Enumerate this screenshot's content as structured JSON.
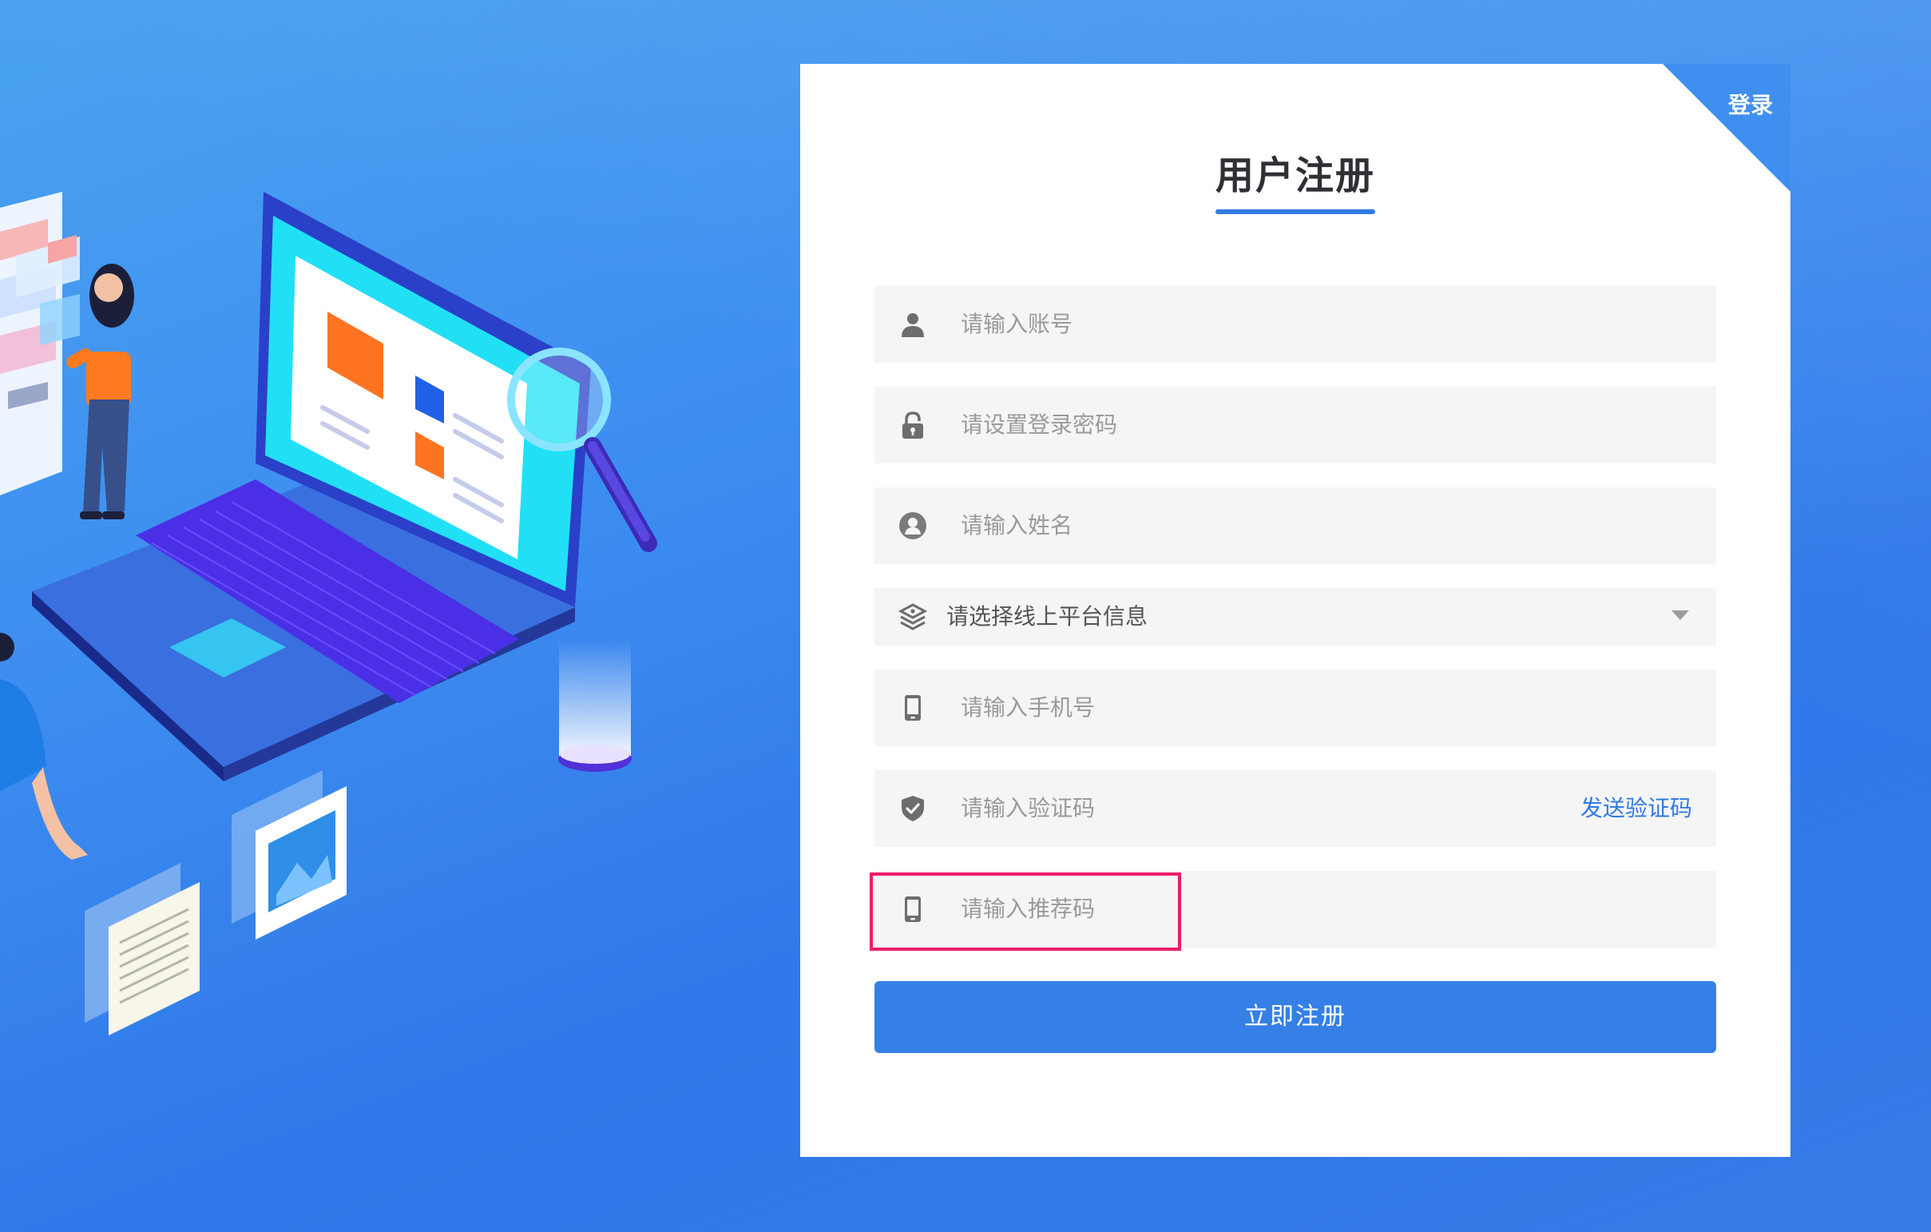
{
  "header": {
    "login_link": "登录",
    "title": "用户注册"
  },
  "form": {
    "account_placeholder": "请输入账号",
    "password_placeholder": "请设置登录密码",
    "name_placeholder": "请输入姓名",
    "platform_select_value": "请选择线上平台信息",
    "phone_placeholder": "请输入手机号",
    "code_placeholder": "请输入验证码",
    "send_code_label": "发送验证码",
    "referral_placeholder": "请输入推荐码",
    "submit_label": "立即注册"
  },
  "colors": {
    "accent": "#2f7ae5",
    "submit": "#3580e6",
    "highlight": "#ee1c6a",
    "field_bg": "#f5f5f5",
    "placeholder": "#9a9a9a"
  },
  "icons": {
    "account": "user-icon",
    "password": "lock-icon",
    "name": "person-circle-icon",
    "platform": "layers-icon",
    "phone": "mobile-icon",
    "code": "shield-check-icon",
    "referral": "mobile-icon"
  }
}
